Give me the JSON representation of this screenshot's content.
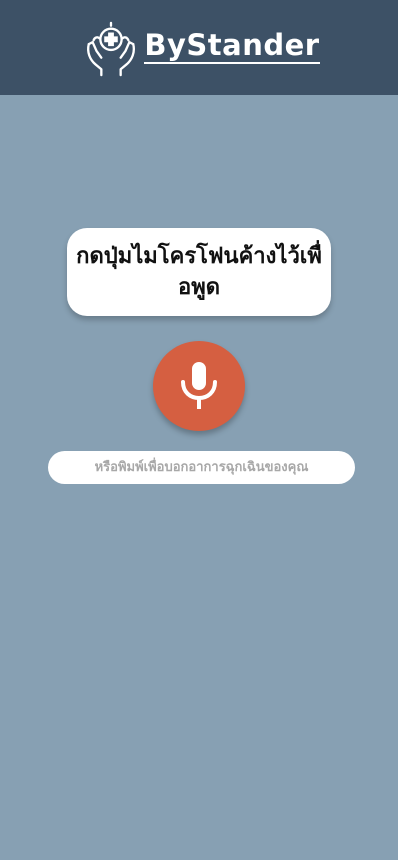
{
  "header": {
    "brand_name": "ByStander",
    "logo_icon": "hands-holding-medical-cross-icon"
  },
  "prompt": {
    "text": "กดปุ่มไมโครโฟนค้างไว้เพื่อพูด"
  },
  "mic_button": {
    "icon": "microphone-icon",
    "color": "#d55f41"
  },
  "emergency_input": {
    "placeholder": "หรือพิมพ์เพื่อบอกอาการฉุกเฉินของคุณ",
    "value": ""
  },
  "colors": {
    "header_bg": "#3d5166",
    "page_bg": "#87a0b3",
    "accent": "#d55f41"
  }
}
